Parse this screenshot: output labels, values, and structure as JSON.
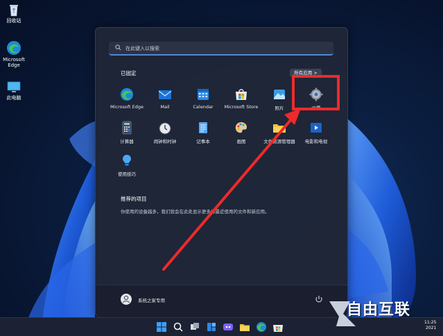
{
  "desktop": {
    "icons": [
      {
        "label": "回收站"
      },
      {
        "label": "Microsoft Edge"
      },
      {
        "label": "此电脑"
      }
    ]
  },
  "start_menu": {
    "search": {
      "placeholder": "在此键入以搜索"
    },
    "pinned": {
      "title": "已固定",
      "all_apps_label": "所有应用 >",
      "apps": [
        {
          "label": "Microsoft Edge",
          "icon": "edge-icon"
        },
        {
          "label": "Mail",
          "icon": "mail-icon"
        },
        {
          "label": "Calendar",
          "icon": "calendar-icon"
        },
        {
          "label": "Microsoft Store",
          "icon": "store-icon"
        },
        {
          "label": "照片",
          "icon": "photos-icon"
        },
        {
          "label": "设置",
          "icon": "settings-icon"
        },
        {
          "label": "计算器",
          "icon": "calculator-icon"
        },
        {
          "label": "闹钟和时钟",
          "icon": "alarm-clock-icon"
        },
        {
          "label": "记事本",
          "icon": "notepad-icon"
        },
        {
          "label": "画图",
          "icon": "paint-icon"
        },
        {
          "label": "文件资源管理器",
          "icon": "file-explorer-icon"
        },
        {
          "label": "电影和电视",
          "icon": "movies-tv-icon"
        },
        {
          "label": "使用技巧",
          "icon": "tips-icon"
        }
      ]
    },
    "recommended": {
      "title": "推荐的项目",
      "description": "你使用的设备越多，我们就会在此处显示更多你最近使用的文件和新应用。"
    },
    "user": {
      "name": "系统之家专用"
    }
  },
  "taskbar": {
    "time": "11:25",
    "date": "2021"
  },
  "watermark": {
    "text": "自由互联"
  },
  "colors": {
    "accent": "#4c89d6",
    "highlight": "#ee2a2a",
    "start_bg": "#1f2638",
    "taskbar_bg": "#1c2233"
  }
}
